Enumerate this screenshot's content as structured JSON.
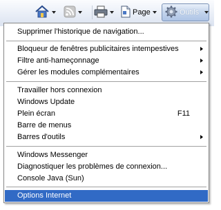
{
  "toolbar": {
    "page_label": "Page",
    "tools_label": "Outils",
    "icons": [
      "home-icon",
      "feeds-icon",
      "print-icon",
      "page-icon",
      "gear-icon"
    ]
  },
  "menu": {
    "items": [
      {
        "label": "Supprimer l'historique de navigation..."
      },
      {
        "label": "Bloqueur de fenêtres publicitaires intempestives",
        "submenu": true
      },
      {
        "label": "Filtre anti-hameçonnage",
        "submenu": true
      },
      {
        "label": "Gérer les modules complémentaires",
        "submenu": true
      },
      {
        "label": "Travailler hors connexion"
      },
      {
        "label": "Windows Update"
      },
      {
        "label": "Plein écran",
        "shortcut": "F11"
      },
      {
        "label": "Barre de menus"
      },
      {
        "label": "Barres d'outils",
        "submenu": true
      },
      {
        "label": "Windows Messenger"
      },
      {
        "label": "Diagnostiquer les problèmes de connexion..."
      },
      {
        "label": "Console Java (Sun)"
      },
      {
        "label": "Options Internet",
        "selected": true
      }
    ]
  },
  "colors": {
    "selection": "#316ac5",
    "toolbar_top": "#fbfcfe",
    "toolbar_bottom": "#dbe3f0"
  }
}
